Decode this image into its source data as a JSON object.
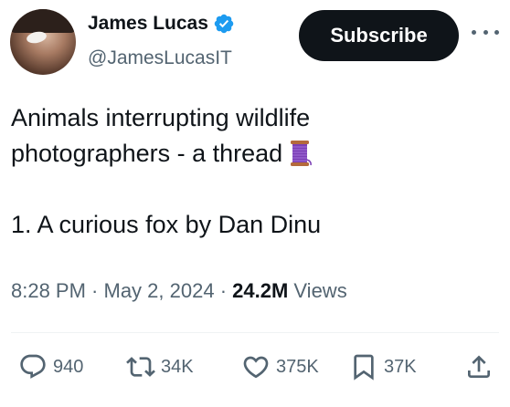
{
  "author": {
    "name": "James Lucas",
    "handle": "@JamesLucasIT",
    "verified": true
  },
  "header": {
    "subscribe_label": "Subscribe",
    "more_icon": "ellipsis-icon"
  },
  "tweet": {
    "line1": "Animals interrupting wildlife",
    "line2": "photographers - a thread",
    "line2_emoji": "thread-spool-icon",
    "line3": "1. A curious fox by Dan Dinu"
  },
  "meta": {
    "time": "8:28 PM",
    "separator1": " · ",
    "date": "May 2, 2024",
    "separator2": " · ",
    "views_count": "24.2M",
    "views_label": " Views"
  },
  "actions": {
    "replies": "940",
    "reposts": "34K",
    "likes": "375K",
    "bookmarks": "37K"
  },
  "colors": {
    "text": "#0f1419",
    "secondary": "#536471",
    "verified": "#1d9bf0",
    "button": "#0f1419"
  }
}
